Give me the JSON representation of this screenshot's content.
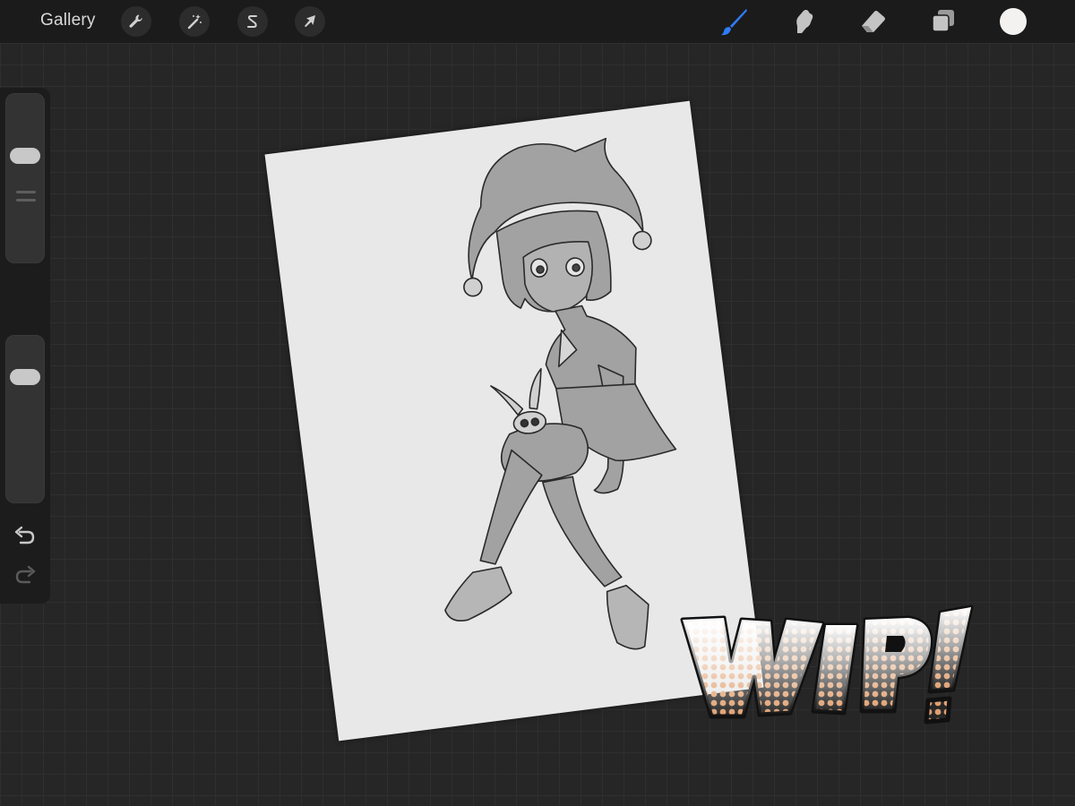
{
  "topbar": {
    "gallery_label": "Gallery",
    "left_tools": [
      "wrench-icon",
      "magic-wand-icon",
      "selection-s-icon",
      "transform-arrow-icon"
    ],
    "right_tools": [
      "brush-icon",
      "smudge-icon",
      "eraser-icon",
      "layers-icon"
    ],
    "active_tool": "brush-icon",
    "active_color": "#f4f1f1",
    "accent_color": "#2f7cf6"
  },
  "sidebar": {
    "brush_size_level": 0.35,
    "opacity_level": 0.25,
    "icons": [
      "modify-square-icon",
      "undo-icon",
      "redo-icon"
    ]
  },
  "canvas": {
    "paper_color": "#e8e8e8",
    "sticker_text": "WIP!",
    "sticker_fill_color": "#e0a070"
  }
}
